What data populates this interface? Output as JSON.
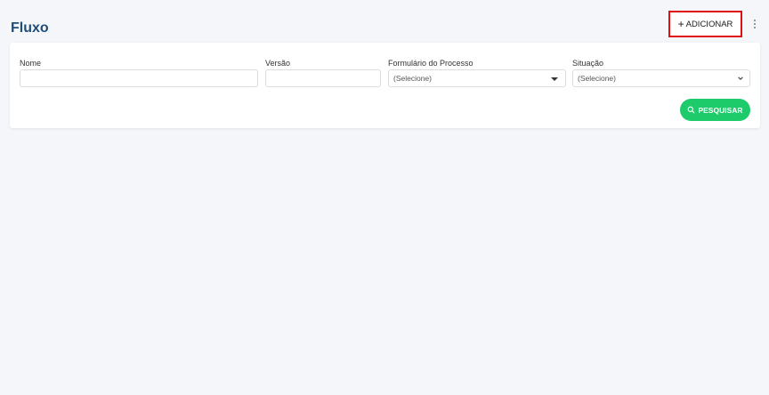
{
  "header": {
    "title": "Fluxo",
    "add_label": "ADICIONAR",
    "add_icon": "+"
  },
  "filters": {
    "nome": {
      "label": "Nome",
      "value": ""
    },
    "versao": {
      "label": "Versão",
      "value": ""
    },
    "formulario": {
      "label": "Formulário do Processo",
      "selected": "(Selecione)"
    },
    "situacao": {
      "label": "Situação",
      "selected": "(Selecione)"
    }
  },
  "actions": {
    "search_label": "PESQUISAR"
  },
  "colors": {
    "title": "#1f4e79",
    "search_button": "#1ecb6b",
    "highlight_border": "#e01010",
    "background": "#f5f6fa"
  }
}
